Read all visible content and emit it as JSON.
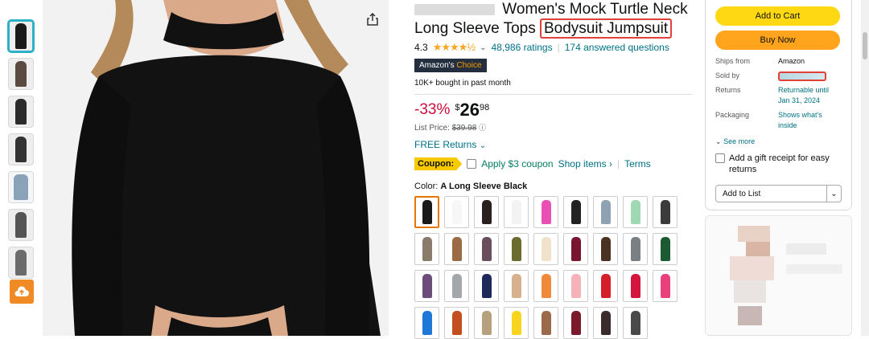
{
  "product": {
    "title_line1": "Women's Mock Turtle Neck",
    "title_line2_a": "Long Sleeve Tops",
    "title_line2_b": "Bodysuit Jumpsuit",
    "rating": "4.3",
    "stars": "★★★★½",
    "ratings_count": "48,986 ratings",
    "answered": "174 answered questions",
    "badge_a": "Amazon's",
    "badge_b": "Choice",
    "bought": "10K+ bought in past month",
    "discount": "-33%",
    "currency": "$",
    "price_dollars": "26",
    "price_cents": "98",
    "list_price_label": "List Price:",
    "list_price": "$39.98",
    "returns": "FREE Returns",
    "coupon_label": "Coupon:",
    "coupon_text": "Apply $3 coupon",
    "shop_items": "Shop items ›",
    "terms": "Terms",
    "color_label": "Color:",
    "color_value": "A Long Sleeve Black"
  },
  "buybox": {
    "add_to_cart": "Add to Cart",
    "buy_now": "Buy Now",
    "ships_from_label": "Ships from",
    "ships_from": "Amazon",
    "sold_by_label": "Sold by",
    "returns_label": "Returns",
    "returns_value": "Returnable until Jan 31, 2024",
    "packaging_label": "Packaging",
    "packaging_value": "Shows what's inside",
    "see_more": "See more",
    "gift": "Add a gift receipt for easy returns",
    "add_to_list": "Add to List"
  },
  "swatch_colors": [
    "#1a1a1a",
    "#f7f7f7",
    "#2a2020",
    "#f3f3f3",
    "#e94fb5",
    "#222222",
    "#8fa2b3",
    "#9fd9b4",
    "#3b3b3b",
    "#8a7b6a",
    "#9b6b45",
    "#6b4e5d",
    "#6b6a2f",
    "#f1e2cc",
    "#7a1530",
    "#4b3324",
    "#7a7f84",
    "#1c5a34",
    "#6b4c7a",
    "#a3a7aa",
    "#1f2a5a",
    "#d7b08e",
    "#f08a3a",
    "#f5b3b9",
    "#d41f2a",
    "#d4153e",
    "#e8407a",
    "#1e78d8",
    "#c24e22",
    "#b7a07d",
    "#f7d51d",
    "#9a6a4a",
    "#7a1a2a",
    "#3b2b2b",
    "#4a4a4a"
  ],
  "colors": {
    "accent_orange": "#e77600",
    "highlight_red": "#e0413a",
    "link": "#007185",
    "discount": "#cc0c39",
    "cart": "#ffd814",
    "buy": "#ffa41c"
  }
}
